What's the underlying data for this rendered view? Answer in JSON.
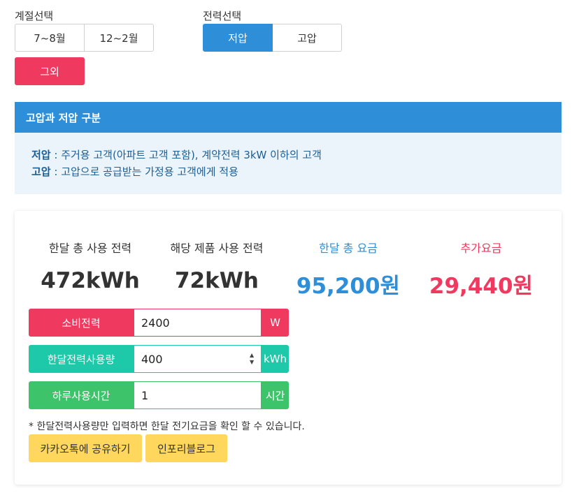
{
  "season": {
    "label": "계절선택",
    "options": [
      "7~8월",
      "12~2월"
    ],
    "other_label": "그외"
  },
  "power": {
    "label": "전력선택",
    "options": [
      "저압",
      "고압"
    ],
    "selected": "저압"
  },
  "info": {
    "title": "고압과 저압 구분",
    "low_term": "저압",
    "low_desc": " : 주거용 고객(아파트 고객 포함), 계약전력 3kW 이하의 고객",
    "high_term": "고압",
    "high_desc": " : 고압으로 공급받는 가정용 고객에게 적용"
  },
  "stats": {
    "monthly_usage_label": "한달 총 사용 전력",
    "monthly_usage_value": "472kWh",
    "product_usage_label": "해당 제품 사용 전력",
    "product_usage_value": "72kWh",
    "monthly_fee_label": "한달 총 요금",
    "monthly_fee_value": "95,200원",
    "extra_fee_label": "추가요금",
    "extra_fee_value": "29,440원"
  },
  "inputs": {
    "consumption": {
      "label": "소비전력",
      "value": "2400",
      "unit": "W"
    },
    "monthly_power": {
      "label": "한달전력사용량",
      "value": "400",
      "unit": "kWh"
    },
    "daily_hours": {
      "label": "하루사용시간",
      "value": "1",
      "unit": "시간"
    }
  },
  "note": "* 한달전력사용량만 입력하면 한달 전기요금을 확인 할 수 있습니다.",
  "share_button": "카카오톡에 공유하기",
  "blog_button": "인포리블로그",
  "colors": {
    "primary": "#2e8ed8",
    "danger": "#f0395f",
    "teal": "#1dc9a8",
    "green": "#3dc46b",
    "yellow": "#ffd75c"
  },
  "icons": {
    "spinner": "spinner-arrows-icon"
  }
}
